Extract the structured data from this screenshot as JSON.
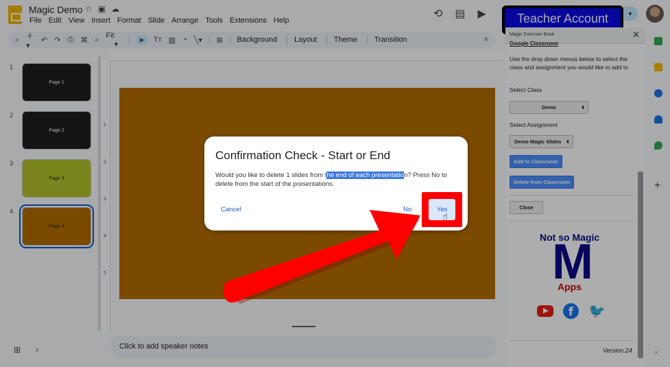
{
  "app": {
    "doc_title": "Magic Demo",
    "menus": [
      "File",
      "Edit",
      "View",
      "Insert",
      "Format",
      "Slide",
      "Arrange",
      "Tools",
      "Extensions",
      "Help"
    ],
    "account_badge": "Teacher Account"
  },
  "toolbar": {
    "zoom": "Fit",
    "background": "Background",
    "layout": "Layout",
    "theme": "Theme",
    "transition": "Transition"
  },
  "slides": [
    {
      "num": "1",
      "label": "Page 1",
      "color": "#1e1e1e",
      "text_color": "#ffffff"
    },
    {
      "num": "2",
      "label": "Page 2",
      "color": "#1e1e1e",
      "text_color": "#ffffff"
    },
    {
      "num": "3",
      "label": "Page 3",
      "color": "#b5c42c",
      "text_color": "#222222"
    },
    {
      "num": "4",
      "label": "Page 4",
      "color": "#b46e00",
      "text_color": "#222222"
    }
  ],
  "ruler": {
    "v_ticks": [
      "1",
      "2",
      "3",
      "4",
      "5"
    ]
  },
  "notes_placeholder": "Click to add speaker notes",
  "sidebar": {
    "title": "Magic Exercise Book",
    "link": "Google Classroom",
    "description": "Use the drop down menus below to select the class and assignment you would like to add to",
    "select_class_label": "Select Class",
    "select_class_value": "Demo",
    "select_assignment_label": "Select Assignment",
    "select_assignment_value": "Demo Magic Slides",
    "add_button": "Add to Classroom",
    "delete_button": "Delete from Classroom",
    "close_button": "Close",
    "brand_line1": "Not so Magic",
    "brand_letter": "M",
    "brand_line2": "Apps",
    "version": "Version.24"
  },
  "dialog": {
    "title": "Confirmation Check - Start or End",
    "text_before": "Would you like to delete 1 slides from t",
    "text_highlight": "he end of each presentatio",
    "text_after": "n? Press No to delete from the start of the presentations.",
    "cancel": "Cancel",
    "no": "No",
    "yes": "Yes"
  },
  "colors": {
    "slide_bg": "#b46e00",
    "accent": "#0b57d0",
    "annotation": "#ff0000",
    "badge_blue": "#0a0ae8"
  }
}
